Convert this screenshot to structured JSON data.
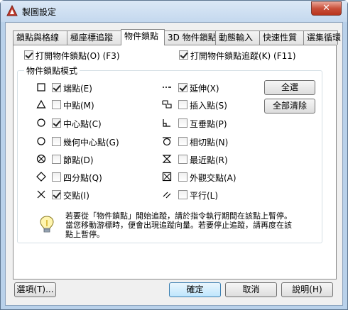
{
  "window": {
    "title": "製圖設定",
    "close_icon": "close-icon"
  },
  "tabs": [
    {
      "label": "鎖點與格線"
    },
    {
      "label": "極座標追蹤"
    },
    {
      "label": "物件鎖點"
    },
    {
      "label": "3D 物件鎖點"
    },
    {
      "label": "動態輸入"
    },
    {
      "label": "快速性質"
    },
    {
      "label": "選集循環"
    }
  ],
  "top": {
    "snap_on": {
      "label": "打開物件鎖點(O) (F3)",
      "checked": true
    },
    "track_on": {
      "label": "打開物件鎖點追蹤(K) (F11)",
      "checked": true
    }
  },
  "group": {
    "title": "物件鎖點模式"
  },
  "modes_left": [
    {
      "label": "端點(E)",
      "checked": true,
      "icon": "endpoint-square-icon"
    },
    {
      "label": "中點(M)",
      "checked": false,
      "icon": "midpoint-triangle-icon"
    },
    {
      "label": "中心點(C)",
      "checked": true,
      "icon": "center-circle-icon"
    },
    {
      "label": "幾何中心點(G)",
      "checked": false,
      "icon": "geometric-center-icon"
    },
    {
      "label": "節點(D)",
      "checked": false,
      "icon": "node-icon"
    },
    {
      "label": "四分點(Q)",
      "checked": false,
      "icon": "quadrant-diamond-icon"
    },
    {
      "label": "交點(I)",
      "checked": true,
      "icon": "intersection-x-icon"
    }
  ],
  "modes_right": [
    {
      "label": "延伸(X)",
      "checked": true,
      "icon": "extension-icon"
    },
    {
      "label": "插入點(S)",
      "checked": false,
      "icon": "insertion-icon"
    },
    {
      "label": "互垂點(P)",
      "checked": false,
      "icon": "perpendicular-icon"
    },
    {
      "label": "相切點(N)",
      "checked": false,
      "icon": "tangent-icon"
    },
    {
      "label": "最近點(R)",
      "checked": false,
      "icon": "nearest-hourglass-icon"
    },
    {
      "label": "外觀交點(A)",
      "checked": false,
      "icon": "apparent-intersection-icon"
    },
    {
      "label": "平行(L)",
      "checked": false,
      "icon": "parallel-icon"
    }
  ],
  "buttons": {
    "select_all": "全選",
    "clear_all": "全部清除"
  },
  "info": {
    "icon": "lightbulb-icon",
    "lines": [
      "若要從「物件鎖點」開始追蹤，請於指令執行期間在該點上暫停。",
      "當您移動游標時，便會出現追蹤向量。若要停止追蹤，請再度在該",
      "點上暫停。"
    ]
  },
  "footer": {
    "options": "選項(T)...",
    "ok": "確定",
    "cancel": "取消",
    "help": "說明(H)"
  }
}
